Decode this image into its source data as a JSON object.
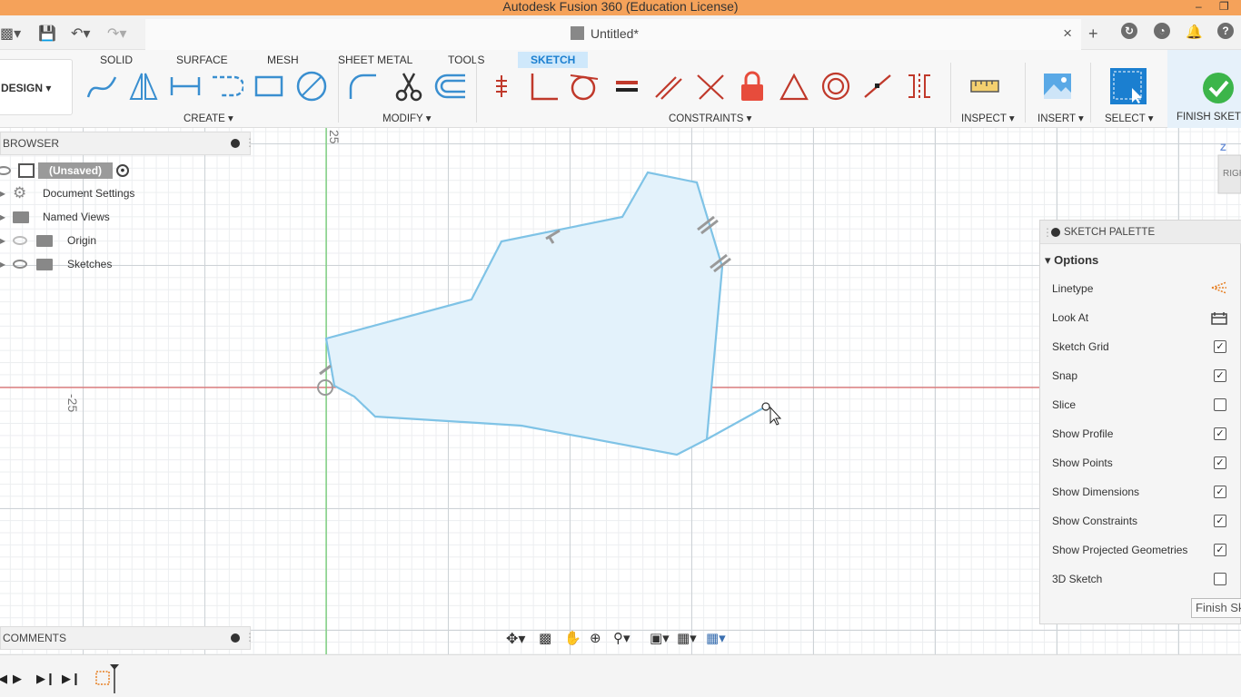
{
  "app": {
    "title": "Autodesk Fusion 360 (Education License)"
  },
  "document": {
    "tab_title": "Untitled*"
  },
  "workspace_tabs": [
    "SOLID",
    "SURFACE",
    "MESH",
    "SHEET METAL",
    "TOOLS",
    "SKETCH"
  ],
  "design_menu": {
    "label": "DESIGN"
  },
  "toolbar_groups": {
    "create": "CREATE",
    "modify": "MODIFY",
    "constraints": "CONSTRAINTS",
    "inspect": "INSPECT",
    "insert": "INSERT",
    "select": "SELECT",
    "finish": "FINISH SKETCH"
  },
  "browser": {
    "title": "BROWSER",
    "items": [
      {
        "label": "(Unsaved)"
      },
      {
        "label": "Document Settings"
      },
      {
        "label": "Named Views"
      },
      {
        "label": "Origin"
      },
      {
        "label": "Sketches"
      }
    ]
  },
  "comments": {
    "title": "COMMENTS"
  },
  "canvas": {
    "ruler_top": "25",
    "ruler_left": "-25"
  },
  "view_cube": {
    "label": "RIGHT"
  },
  "sketch_palette": {
    "title": "SKETCH PALETTE",
    "section": "Options",
    "options": [
      {
        "label": "Linetype",
        "type": "icon"
      },
      {
        "label": "Look At",
        "type": "icon"
      },
      {
        "label": "Sketch Grid",
        "checked": true
      },
      {
        "label": "Snap",
        "checked": true
      },
      {
        "label": "Slice",
        "checked": false
      },
      {
        "label": "Show Profile",
        "checked": true
      },
      {
        "label": "Show Points",
        "checked": true
      },
      {
        "label": "Show Dimensions",
        "checked": true
      },
      {
        "label": "Show Constraints",
        "checked": true
      },
      {
        "label": "Show Projected Geometries",
        "checked": true
      },
      {
        "label": "3D Sketch",
        "checked": false
      }
    ],
    "finish_button": "Finish Sketch"
  },
  "colors": {
    "accent": "#1b7fd0",
    "titlebar": "#f5a25a",
    "sketch_line": "#7fc3e6",
    "profile_fill": "#e3f2fb",
    "x_axis": "#e05050",
    "y_axis": "#6ccf6c"
  }
}
